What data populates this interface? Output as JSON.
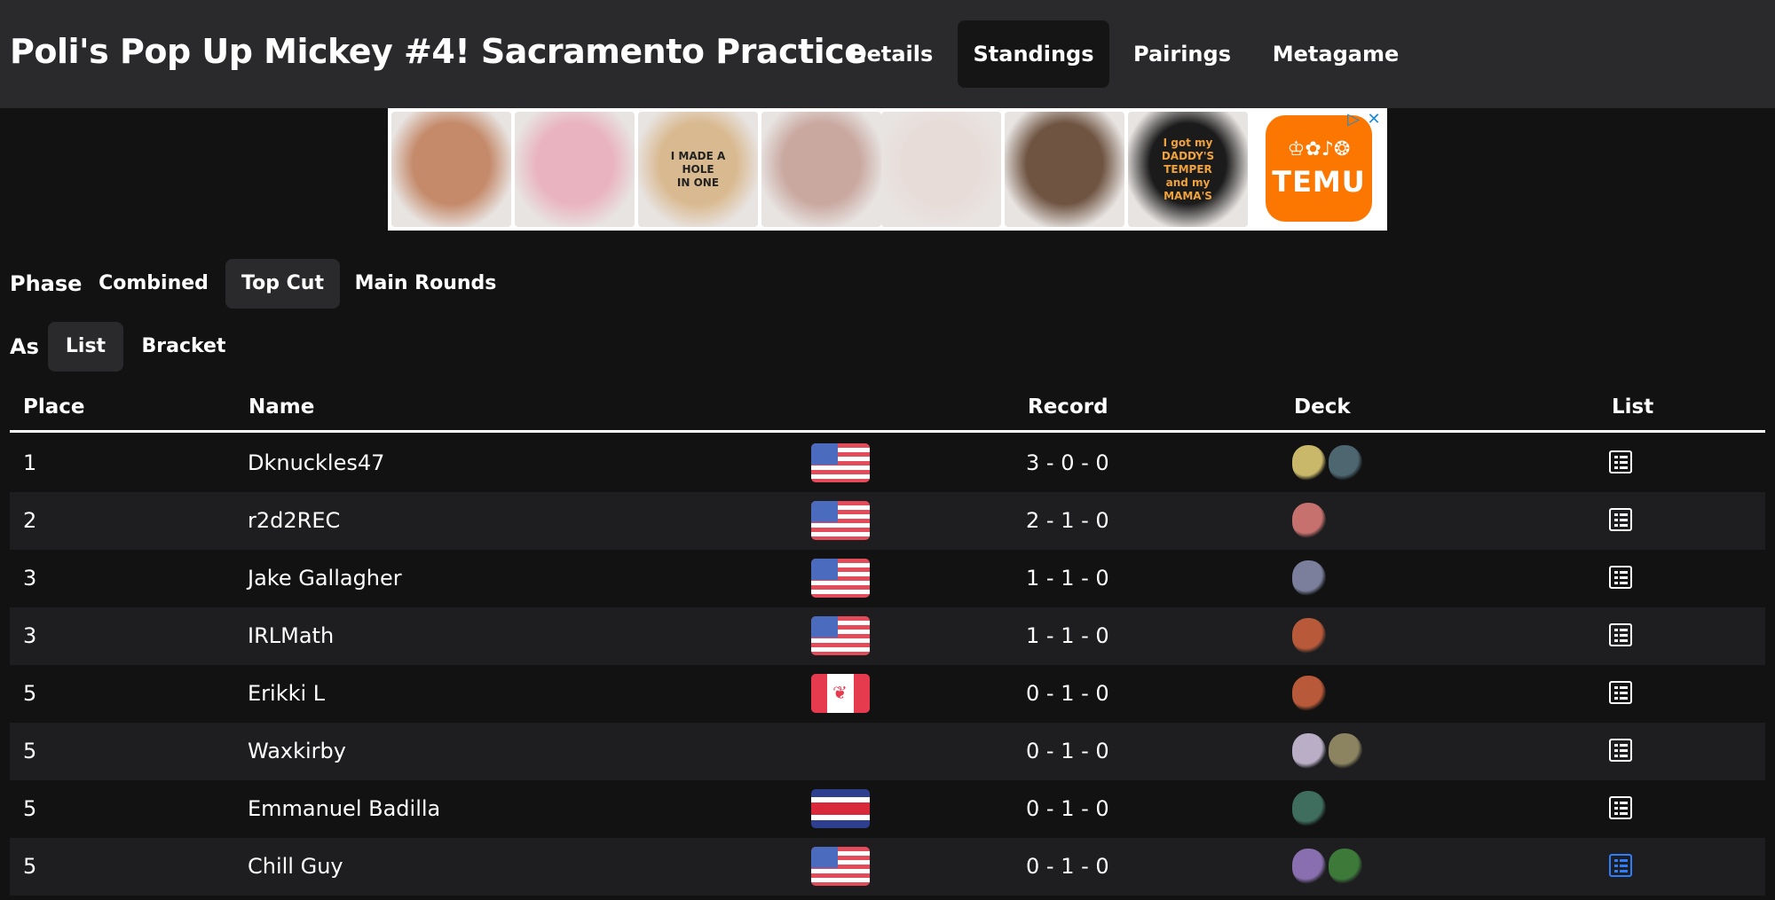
{
  "header": {
    "title": "Poli's Pop Up Mickey #4! Sacramento Practice",
    "tabs": [
      {
        "label": "Details",
        "active": false
      },
      {
        "label": "Standings",
        "active": true
      },
      {
        "label": "Pairings",
        "active": false
      },
      {
        "label": "Metagame",
        "active": false
      }
    ]
  },
  "ad": {
    "brand": "TEMU",
    "brand_glyphs": "♔✿♪❂",
    "brand_color": "#fb7701",
    "products": [
      {
        "icon": "face-pillow-image",
        "color": "#c48a6a"
      },
      {
        "icon": "pink-top-image",
        "color": "#e9b4bf"
      },
      {
        "icon": "tan-tshirt-image",
        "color": "#d9b98f",
        "lines": [
          "I MADE A",
          "HOLE",
          "IN ONE"
        ]
      },
      {
        "icon": "metallic-leggings-image",
        "color": "#c9a8a0"
      },
      {
        "icon": "white-crop-top-image",
        "color": "#e8dcd8"
      },
      {
        "icon": "brown-bodysuit-image",
        "color": "#6f5442"
      },
      {
        "icon": "kids-black-tshirt-image",
        "color": "#1b1b1b",
        "lines": [
          "I got my",
          "DADDY'S",
          "TEMPER",
          "and my",
          "MAMA'S"
        ]
      }
    ]
  },
  "phase": {
    "label": "Phase",
    "options": [
      {
        "label": "Combined",
        "active": false
      },
      {
        "label": "Top Cut",
        "active": true
      },
      {
        "label": "Main Rounds",
        "active": false
      }
    ]
  },
  "view_as": {
    "label": "As",
    "options": [
      {
        "label": "List",
        "active": true
      },
      {
        "label": "Bracket",
        "active": false
      }
    ]
  },
  "table": {
    "headers": {
      "place": "Place",
      "name": "Name",
      "record": "Record",
      "deck": "Deck",
      "list": "List"
    },
    "rows": [
      {
        "place": "1",
        "name": "Dknuckles47",
        "flag": "us",
        "record": "3 - 0 - 0",
        "deck_icons": [
          {
            "icon": "mimikyu-sprite",
            "color": "#c9b86a"
          },
          {
            "icon": "dark-pokemon-sprite",
            "color": "#4d6670"
          }
        ],
        "list_highlight": false
      },
      {
        "place": "2",
        "name": "r2d2REC",
        "flag": "us",
        "record": "2 - 1 - 0",
        "deck_icons": [
          {
            "icon": "pink-pokemon-sprite",
            "color": "#c7716e"
          }
        ],
        "list_highlight": false
      },
      {
        "place": "3",
        "name": "Jake Gallagher",
        "flag": "us",
        "record": "1 - 1 - 0",
        "deck_icons": [
          {
            "icon": "armored-pokemon-sprite",
            "color": "#7b7f9c"
          }
        ],
        "list_highlight": false
      },
      {
        "place": "3",
        "name": "IRLMath",
        "flag": "us",
        "record": "1 - 1 - 0",
        "deck_icons": [
          {
            "icon": "rock-pokemon-sprite",
            "color": "#b85a3a"
          }
        ],
        "list_highlight": false
      },
      {
        "place": "5",
        "name": "Erikki L",
        "flag": "ca",
        "record": "0 - 1 - 0",
        "deck_icons": [
          {
            "icon": "rock-pokemon-sprite",
            "color": "#b85a3a"
          }
        ],
        "list_highlight": false
      },
      {
        "place": "5",
        "name": "Waxkirby",
        "flag": "",
        "record": "0 - 1 - 0",
        "deck_icons": [
          {
            "icon": "white-purple-pokemon-sprite",
            "color": "#b9aec6"
          },
          {
            "icon": "ghost-pokemon-sprite",
            "color": "#8c8460"
          }
        ],
        "list_highlight": false
      },
      {
        "place": "5",
        "name": "Emmanuel Badilla",
        "flag": "cr",
        "record": "0 - 1 - 0",
        "deck_icons": [
          {
            "icon": "green-red-pokemon-sprite",
            "color": "#3f6e5f"
          }
        ],
        "list_highlight": false
      },
      {
        "place": "5",
        "name": "Chill Guy",
        "flag": "us",
        "record": "0 - 1 - 0",
        "deck_icons": [
          {
            "icon": "purple-pokemon-sprite",
            "color": "#8a6fb0"
          },
          {
            "icon": "green-pokemon-sprite",
            "color": "#3d7a3a"
          }
        ],
        "list_highlight": true
      }
    ]
  }
}
